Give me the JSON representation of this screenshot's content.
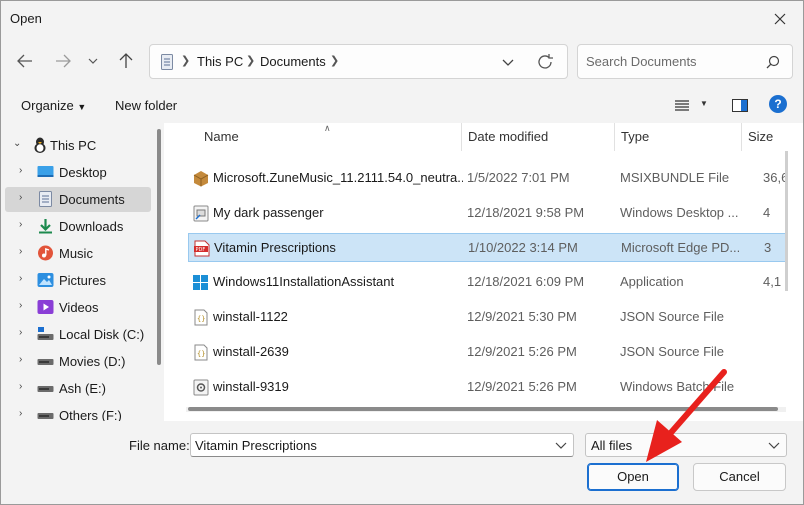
{
  "window": {
    "title": "Open"
  },
  "address": {
    "crumbs": [
      "This PC",
      "Documents"
    ]
  },
  "search": {
    "placeholder": "Search Documents"
  },
  "command_bar": {
    "organize": "Organize",
    "new_folder": "New folder",
    "help": "?"
  },
  "nav_pane": {
    "items": [
      {
        "label": "This PC",
        "icon": "this-pc-icon",
        "expanded": true
      },
      {
        "label": "Desktop",
        "icon": "desktop-icon"
      },
      {
        "label": "Documents",
        "icon": "documents-icon",
        "selected": true
      },
      {
        "label": "Downloads",
        "icon": "downloads-icon"
      },
      {
        "label": "Music",
        "icon": "music-icon"
      },
      {
        "label": "Pictures",
        "icon": "pictures-icon"
      },
      {
        "label": "Videos",
        "icon": "videos-icon"
      },
      {
        "label": "Local Disk (C:)",
        "icon": "local-disk-icon"
      },
      {
        "label": "Movies (D:)",
        "icon": "drive-icon"
      },
      {
        "label": "Ash (E:)",
        "icon": "drive-icon"
      },
      {
        "label": "Others (F:)",
        "icon": "drive-icon"
      }
    ]
  },
  "columns": {
    "name": "Name",
    "date": "Date modified",
    "type": "Type",
    "size": "Size"
  },
  "files": [
    {
      "name": "Microsoft.ZuneMusic_11.2111.54.0_neutra...",
      "date": "1/5/2022 7:01 PM",
      "type": "MSIXBUNDLE File",
      "size": "36,6",
      "icon": "package-icon"
    },
    {
      "name": "My dark passenger",
      "date": "12/18/2021 9:58 PM",
      "type": "Windows Desktop ...",
      "size": "4",
      "icon": "shortcut-icon"
    },
    {
      "name": "Vitamin Prescriptions",
      "date": "1/10/2022 3:14 PM",
      "type": "Microsoft Edge PD...",
      "size": "3",
      "icon": "pdf-icon",
      "selected": true
    },
    {
      "name": "Windows11InstallationAssistant",
      "date": "12/18/2021 6:09 PM",
      "type": "Application",
      "size": "4,1",
      "icon": "windows-app-icon"
    },
    {
      "name": "winstall-1122",
      "date": "12/9/2021 5:30 PM",
      "type": "JSON Source File",
      "size": "",
      "icon": "json-file-icon"
    },
    {
      "name": "winstall-2639",
      "date": "12/9/2021 5:26 PM",
      "type": "JSON Source File",
      "size": "",
      "icon": "json-file-icon"
    },
    {
      "name": "winstall-9319",
      "date": "12/9/2021 5:26 PM",
      "type": "Windows Batch File",
      "size": "",
      "icon": "batch-file-icon"
    }
  ],
  "footer": {
    "file_name_label": "File name:",
    "file_name_value": "Vitamin Prescriptions",
    "filter_value": "All files",
    "open_label": "Open",
    "cancel_label": "Cancel"
  },
  "colors": {
    "accent": "#1b6fd0",
    "selection": "#cce4f7",
    "annotation_arrow": "#e8211d"
  }
}
